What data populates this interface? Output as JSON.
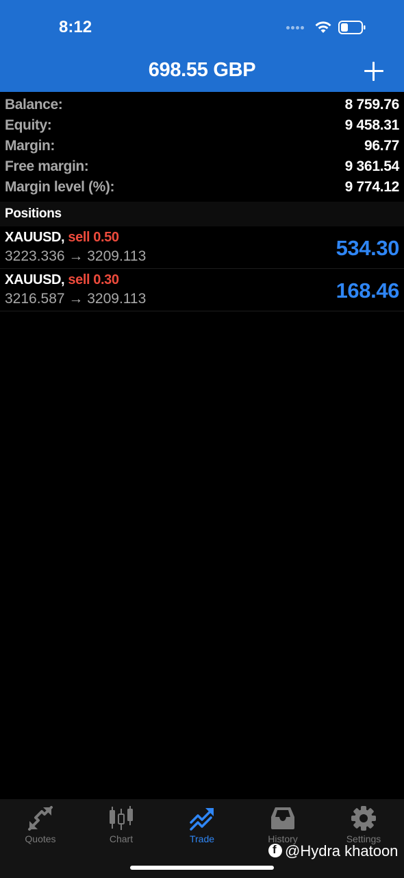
{
  "status_bar": {
    "time": "8:12"
  },
  "header": {
    "title": "698.55 GBP"
  },
  "summary": [
    {
      "label": "Balance:",
      "value": "8 759.76"
    },
    {
      "label": "Equity:",
      "value": "9 458.31"
    },
    {
      "label": "Margin:",
      "value": "96.77"
    },
    {
      "label": "Free margin:",
      "value": "9 361.54"
    },
    {
      "label": "Margin level (%):",
      "value": "9 774.12"
    }
  ],
  "positions_section": {
    "title": "Positions"
  },
  "positions": [
    {
      "symbol": "XAUUSD,",
      "side_volume": "sell 0.50",
      "prices": "3223.336 → 3209.113",
      "profit": "534.30"
    },
    {
      "symbol": "XAUUSD,",
      "side_volume": "sell 0.30",
      "prices": "3216.587 → 3209.113",
      "profit": "168.46"
    }
  ],
  "tabbar": {
    "tabs": [
      {
        "label": "Quotes",
        "icon": "quotes-icon"
      },
      {
        "label": "Chart",
        "icon": "candlestick-chart-icon"
      },
      {
        "label": "Trade",
        "icon": "trade-trend-icon",
        "active": true
      },
      {
        "label": "History",
        "icon": "inbox-history-icon"
      },
      {
        "label": "Settings",
        "icon": "gear-icon"
      }
    ]
  },
  "watermark": {
    "text": "@Hydra khatoon",
    "icon": "facebook-icon"
  },
  "colors": {
    "header_bg": "#1f6fd1",
    "profit_blue": "#2f86f5",
    "sell_red": "#ee4b3c",
    "label_gray": "#a8a8a8"
  }
}
